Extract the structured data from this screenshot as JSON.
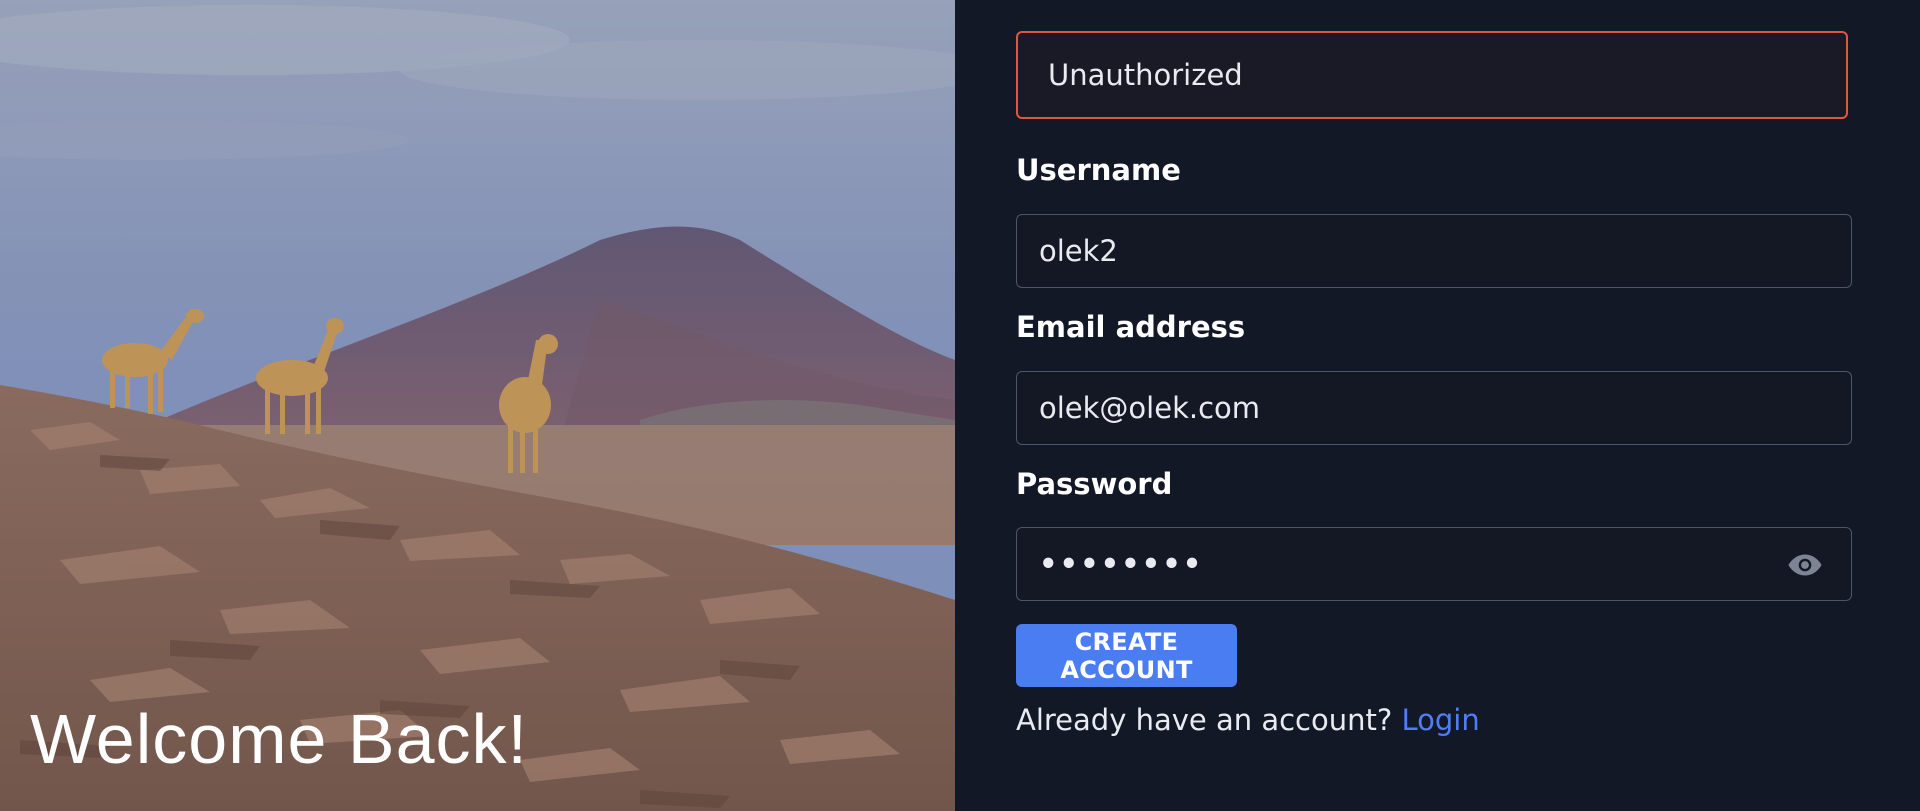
{
  "hero": {
    "title": "Welcome Back!"
  },
  "form": {
    "alert_text": "Unauthorized",
    "username": {
      "label": "Username",
      "value": "olek2"
    },
    "email": {
      "label": "Email address",
      "value": "olek@olek.com"
    },
    "password": {
      "label": "Password",
      "value": "••••••••",
      "toggle_icon": "eye-icon"
    },
    "submit_label": "CREATE ACCOUNT",
    "footer_text": "Already have an account?",
    "footer_link": "Login"
  },
  "colors": {
    "background": "#131826",
    "accent": "#4a7cf2",
    "link": "#4f7df5",
    "error_border": "#e0573f"
  }
}
